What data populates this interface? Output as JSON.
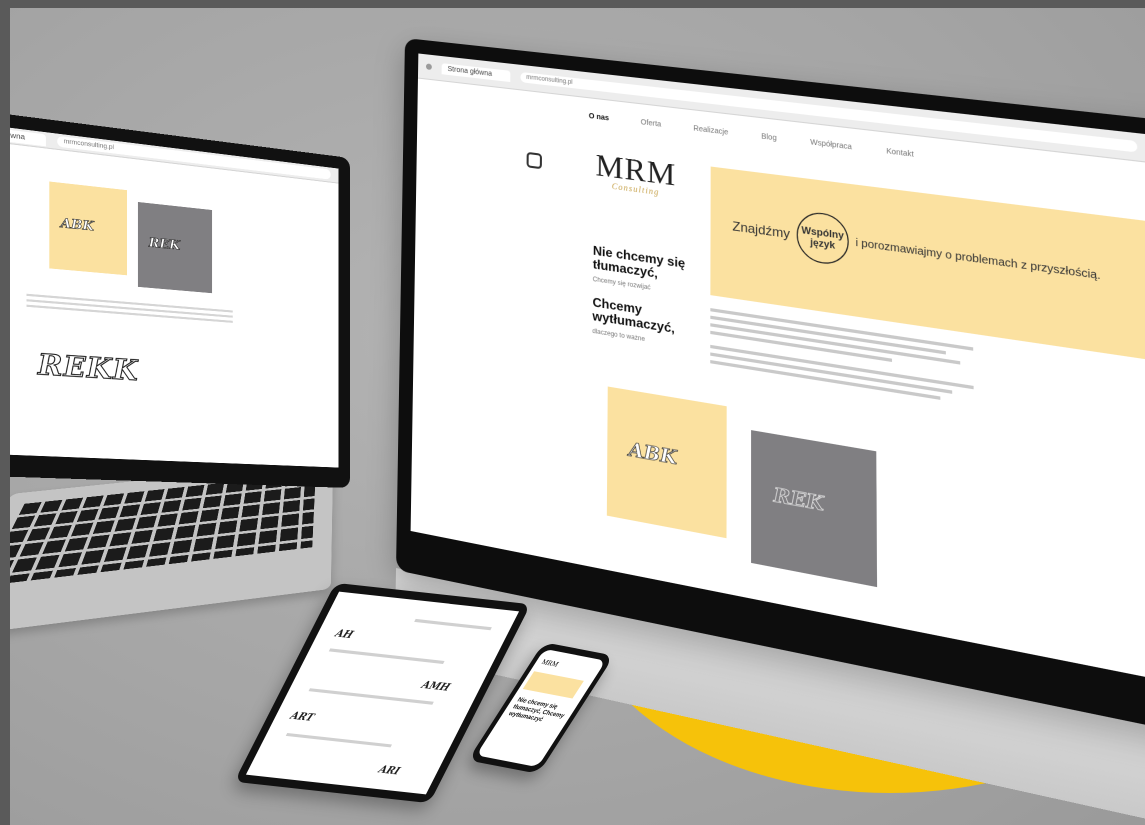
{
  "colors": {
    "background": "#a5a5a5",
    "accent_yellow": "#f6c20a",
    "pale_yellow": "#fbe1a0",
    "card_gray": "#807f82"
  },
  "desktop": {
    "browser": {
      "tab_title": "Strona główna",
      "url": "mrmconsulting.pl"
    },
    "nav": [
      "O nas",
      "Oferta",
      "Realizacje",
      "Blog",
      "Współpraca",
      "Kontakt"
    ],
    "logo": {
      "name": "MRM",
      "sub": "Consulting"
    },
    "hero": {
      "left": "Znajdźmy",
      "circle": "Wspólny język",
      "right": "i porozmawiajmy o problemach z przyszłością."
    },
    "tagline_1": "Nie chcemy się tłumaczyć,",
    "tagline_1_sub": "Chcemy się rozwijać",
    "tagline_2": "Chcemy wytłumaczyć,",
    "tagline_2_sub": "dlaczego to ważne",
    "card_yellow_mark": "ABK",
    "card_gray_mark": "REK"
  },
  "laptop": {
    "card_yellow_mark": "ABK",
    "card_gray_mark": "REK",
    "logo_mark": "REKK"
  },
  "tablet": {
    "words": [
      "AH",
      "AMH",
      "ART",
      "ARI"
    ]
  },
  "phone": {
    "logo": "MRM",
    "text": "Nie chcemy się tłumaczyć, Chcemy wytłumaczyć"
  }
}
